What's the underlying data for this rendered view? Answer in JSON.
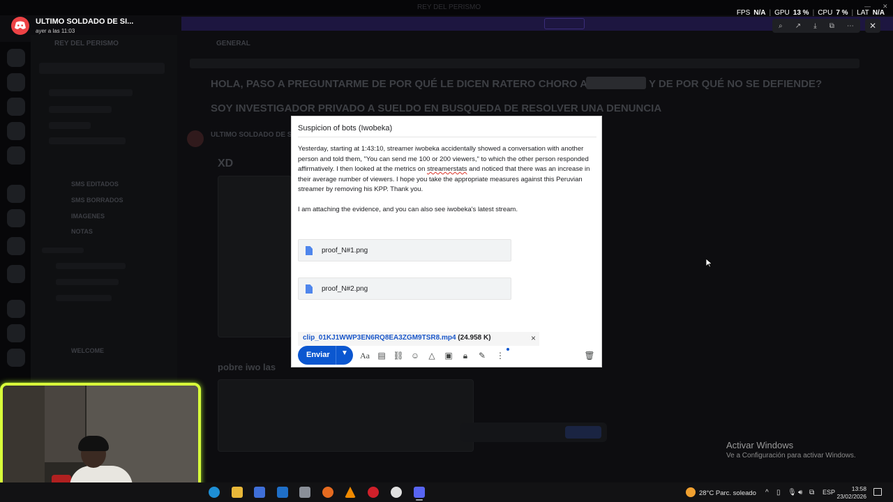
{
  "notification": {
    "title": "ULTIMO SOLDADO DE SI...",
    "subtitle": "ayer a las 11:03"
  },
  "overlay": {
    "fps_label": "FPS",
    "fps_value": "N/A",
    "gpu_label": "GPU",
    "gpu_value": "13 %",
    "cpu_label": "CPU",
    "cpu_value": "7 %",
    "lat_label": "LAT",
    "lat_value": "N/A"
  },
  "background": {
    "top_title": "REY DEL PERISMO",
    "channel_header": "GENERAL",
    "server_name": "REY DEL PERISMO",
    "heading1": "HOLA, PASO A PREGUNTARME DE POR QUÉ LE DICEN RATERO CHORO A",
    "heading1_end": "Y DE POR QUÉ NO SE DEFIENDE?",
    "heading2": "SOY INVESTIGADOR PRIVADO A SUELDO EN BUSQUEDA DE RESOLVER UNA DENUNCIA",
    "msg_author": "ULTIMO SOLDADO DE S",
    "msg_xd": "XD",
    "channels": [
      "SMS EDITADOS",
      "SMS BORRADOS",
      "IMAGENES",
      "NOTAS",
      "WELCOME"
    ],
    "bottom_heading": "pobre iwo las"
  },
  "compose": {
    "subject": "Suspicion of bots (Iwobeka)",
    "para1_a": "Yesterday, starting at 1:43:10, streamer iwobeka accidentally showed a conversation with another person and told them, \"You can send me 100 or 200 viewers,\" to which the other person responded affirmatively. I then looked at the metrics on ",
    "para1_link": "streamerstats",
    "para1_b": " and noticed that there was an increase in their average number of viewers. I hope you take the appropriate measures against this Peruvian streamer  by removing his KPP. Thank you.",
    "para2": "I am attaching the evidence, and you can also see iwobeka's latest stream.",
    "attachments": [
      {
        "name": "proof_N#1.png"
      },
      {
        "name": "proof_N#2.png"
      }
    ],
    "clip_name": "clip_01KJ1WWP3EN6RQ8EA3ZGM9TSR8.mp4",
    "clip_size": "(24.958 K)",
    "send_label": "Enviar"
  },
  "activation": {
    "title": "Activar Windows",
    "subtitle": "Ve a Configuración para activar Windows."
  },
  "taskbar": {
    "weather": "28°C  Parc. soleado",
    "lang": "ESP",
    "time": "13:58",
    "date": "23/02/2026"
  },
  "colors": {
    "send_button": "#0b57d0",
    "webcam_border": "#d8ff3a",
    "discord_red": "#ed4245"
  }
}
